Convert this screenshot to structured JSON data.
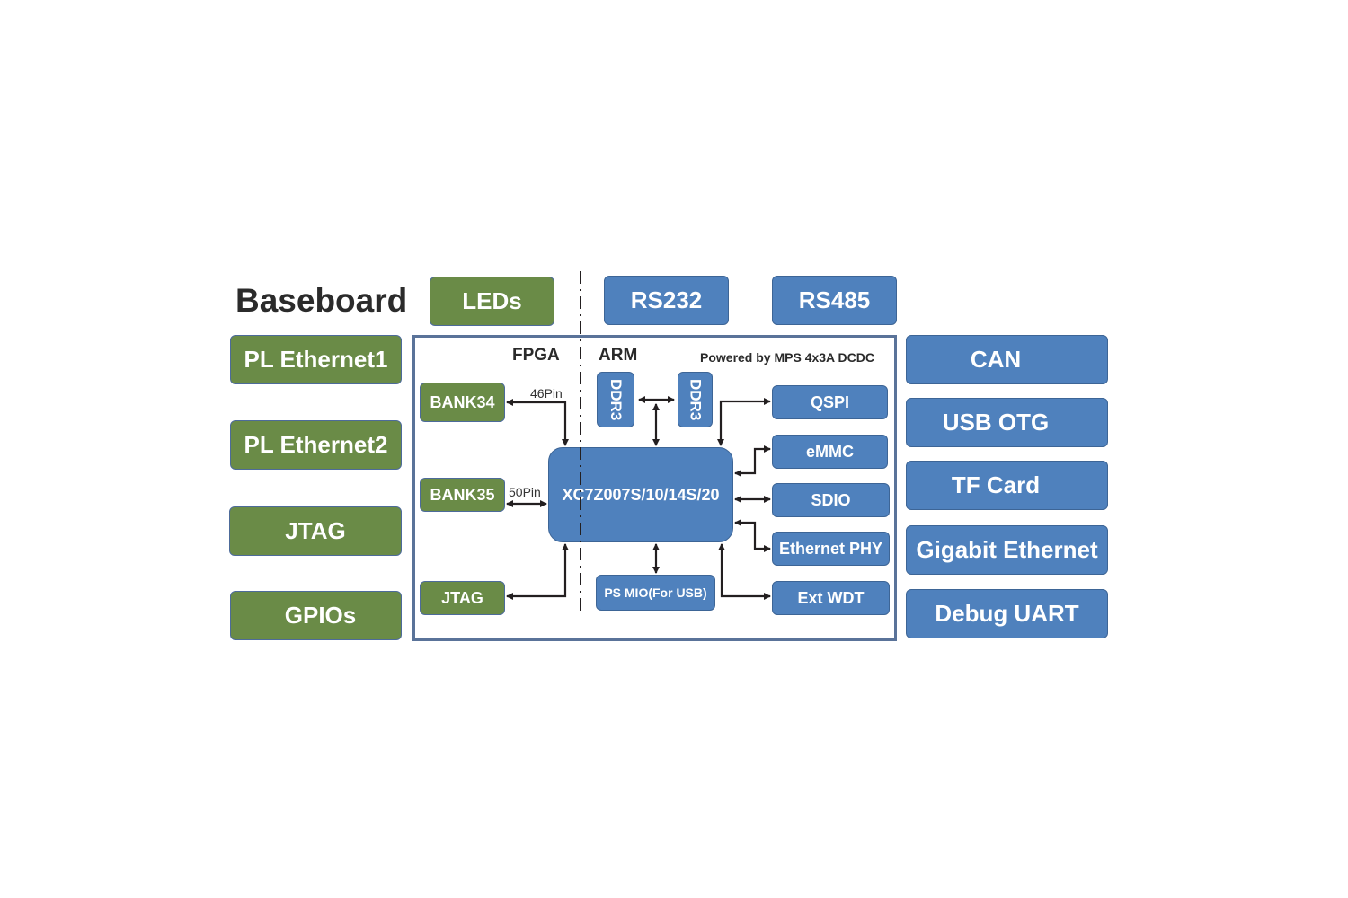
{
  "title": "Baseboard",
  "top_modules": {
    "leds": "LEDs",
    "rs232": "RS232",
    "rs485": "RS485"
  },
  "left_modules": [
    "PL Ethernet1",
    "PL Ethernet2",
    "JTAG",
    "GPIOs"
  ],
  "right_modules": [
    "CAN",
    "USB OTG",
    "TF Card",
    "Gigabit Ethernet",
    "Debug UART"
  ],
  "core_board": {
    "fpga_label": "FPGA",
    "arm_label": "ARM",
    "power_note": "Powered by MPS 4x3A DCDC",
    "chip": "XC7Z007S/10/14S/20",
    "pl_blocks": {
      "bank34": "BANK34",
      "bank35": "BANK35",
      "jtag": "JTAG"
    },
    "pin_labels": {
      "bank34": "46Pin",
      "bank35": "50Pin"
    },
    "ddr": [
      "DDR3",
      "DDR3"
    ],
    "ps_mio": "PS MIO(For USB)",
    "peripherals": [
      "QSPI",
      "eMMC",
      "SDIO",
      "Ethernet PHY",
      "Ext WDT"
    ]
  },
  "colors": {
    "pl_green": "#6a8b47",
    "ps_blue": "#4f81bd",
    "frame": "#5a7399",
    "wire": "#231f20"
  }
}
